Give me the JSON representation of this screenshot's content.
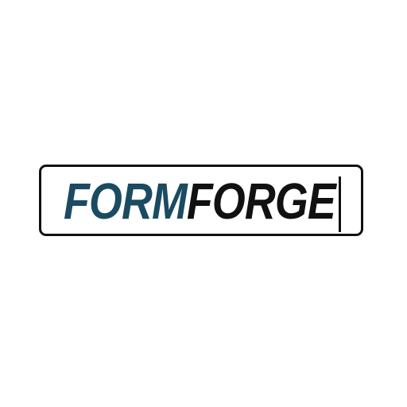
{
  "logo": {
    "word_primary": "FORM",
    "word_secondary": "FORGE",
    "primary_color": "#1b4b61",
    "secondary_color": "#111111",
    "frame_color": "#111111",
    "background_color": "#ffffff"
  }
}
